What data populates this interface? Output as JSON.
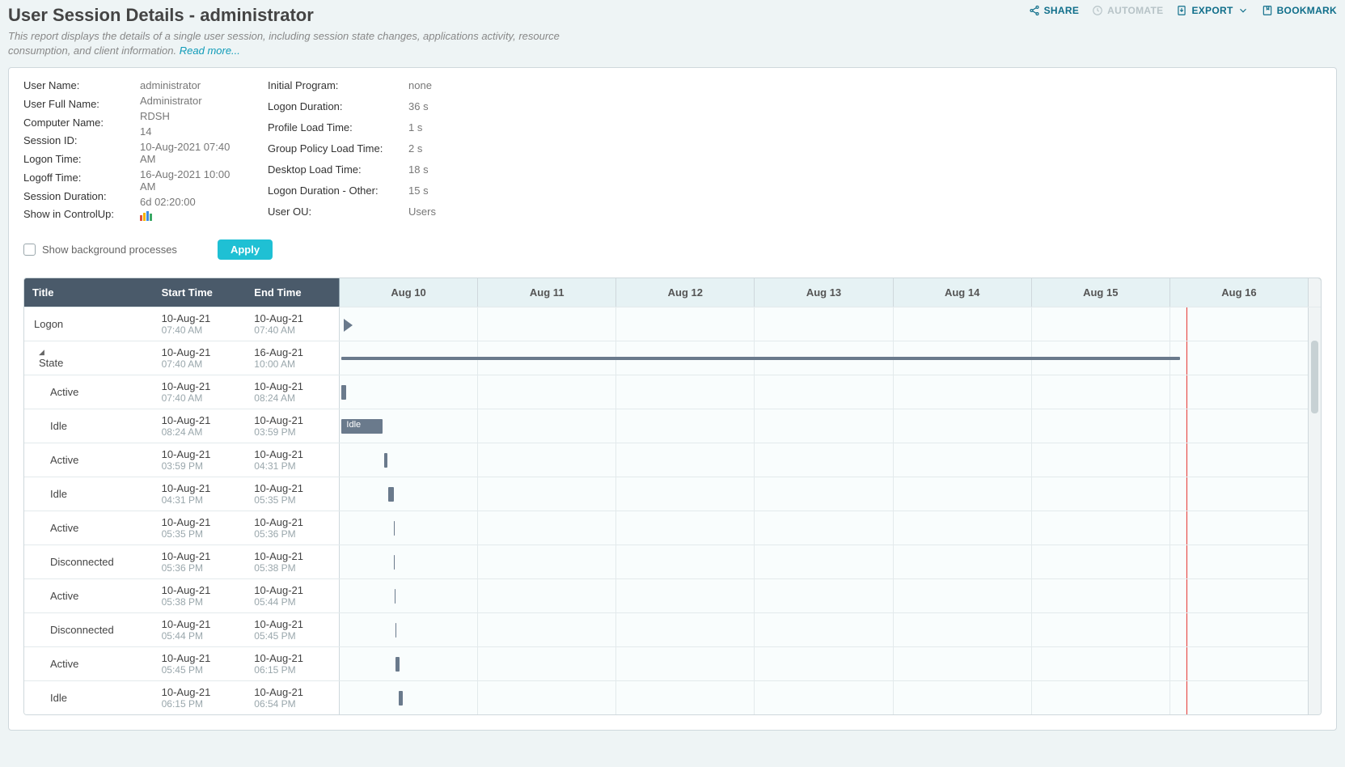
{
  "header": {
    "title": "User Session Details - administrator",
    "subtitle": "This report displays the details of a single user session, including session state changes, applications activity, resource consumption, and client information.",
    "readmore": "Read more..."
  },
  "actions": {
    "share": "SHARE",
    "automate": "AUTOMATE",
    "export": "EXPORT",
    "bookmark": "BOOKMARK"
  },
  "details": {
    "labels1": [
      "User Name:",
      "User Full Name:",
      "Computer Name:",
      "Session ID:",
      "Logon Time:",
      "Logoff Time:",
      "Session Duration:",
      "Show in ControlUp:"
    ],
    "values1": [
      "administrator",
      "Administrator",
      "RDSH",
      "14",
      "10-Aug-2021 07:40 AM",
      "16-Aug-2021 10:00 AM",
      "6d 02:20:00",
      ""
    ],
    "labels2": [
      "Initial Program:",
      "Logon Duration:",
      "Profile Load Time:",
      "Group Policy Load Time:",
      "Desktop Load Time:",
      "Logon Duration - Other:",
      "User OU:"
    ],
    "values2": [
      "none",
      "36 s",
      "1 s",
      "2 s",
      "18 s",
      "15 s",
      "Users"
    ]
  },
  "controls": {
    "checkbox": "Show background processes",
    "apply": "Apply"
  },
  "grid": {
    "columns": {
      "title": "Title",
      "start": "Start Time",
      "end": "End Time"
    },
    "days": [
      "Aug 10",
      "Aug 11",
      "Aug 12",
      "Aug 13",
      "Aug 14",
      "Aug 15",
      "Aug 16"
    ],
    "rows": [
      {
        "title": "Logon",
        "indent": 0,
        "start_d": "10-Aug-21",
        "start_t": "07:40 AM",
        "end_d": "10-Aug-21",
        "end_t": "07:40 AM",
        "type": "marker",
        "left": 0.4
      },
      {
        "title": "State",
        "indent": 1,
        "caret": true,
        "start_d": "10-Aug-21",
        "start_t": "07:40 AM",
        "end_d": "16-Aug-21",
        "end_t": "10:00 AM",
        "type": "bar-thin",
        "left": 0.2,
        "width": 86.6
      },
      {
        "title": "Active",
        "indent": 2,
        "start_d": "10-Aug-21",
        "start_t": "07:40 AM",
        "end_d": "10-Aug-21",
        "end_t": "08:24 AM",
        "type": "bar",
        "left": 0.2,
        "width": 0.5
      },
      {
        "title": "Idle",
        "indent": 2,
        "start_d": "10-Aug-21",
        "start_t": "08:24 AM",
        "end_d": "10-Aug-21",
        "end_t": "03:59 PM",
        "type": "bar-label",
        "label": "Idle",
        "left": 0.2,
        "width": 4.2
      },
      {
        "title": "Active",
        "indent": 2,
        "start_d": "10-Aug-21",
        "start_t": "03:59 PM",
        "end_d": "10-Aug-21",
        "end_t": "04:31 PM",
        "type": "bar",
        "left": 4.6,
        "width": 0.35
      },
      {
        "title": "Idle",
        "indent": 2,
        "start_d": "10-Aug-21",
        "start_t": "04:31 PM",
        "end_d": "10-Aug-21",
        "end_t": "05:35 PM",
        "type": "bar",
        "left": 5.0,
        "width": 0.6
      },
      {
        "title": "Active",
        "indent": 2,
        "start_d": "10-Aug-21",
        "start_t": "05:35 PM",
        "end_d": "10-Aug-21",
        "end_t": "05:36 PM",
        "type": "bar",
        "left": 5.6,
        "width": 0.12
      },
      {
        "title": "Disconnected",
        "indent": 2,
        "start_d": "10-Aug-21",
        "start_t": "05:36 PM",
        "end_d": "10-Aug-21",
        "end_t": "05:38 PM",
        "type": "bar",
        "left": 5.6,
        "width": 0.12
      },
      {
        "title": "Active",
        "indent": 2,
        "start_d": "10-Aug-21",
        "start_t": "05:38 PM",
        "end_d": "10-Aug-21",
        "end_t": "05:44 PM",
        "type": "bar",
        "left": 5.65,
        "width": 0.12
      },
      {
        "title": "Disconnected",
        "indent": 2,
        "start_d": "10-Aug-21",
        "start_t": "05:44 PM",
        "end_d": "10-Aug-21",
        "end_t": "05:45 PM",
        "type": "bar",
        "left": 5.75,
        "width": 0.12
      },
      {
        "title": "Active",
        "indent": 2,
        "start_d": "10-Aug-21",
        "start_t": "05:45 PM",
        "end_d": "10-Aug-21",
        "end_t": "06:15 PM",
        "type": "bar",
        "left": 5.8,
        "width": 0.35
      },
      {
        "title": "Idle",
        "indent": 2,
        "start_d": "10-Aug-21",
        "start_t": "06:15 PM",
        "end_d": "10-Aug-21",
        "end_t": "06:54 PM",
        "type": "bar",
        "left": 6.1,
        "width": 0.45
      }
    ],
    "redline_percent": 87.5
  }
}
